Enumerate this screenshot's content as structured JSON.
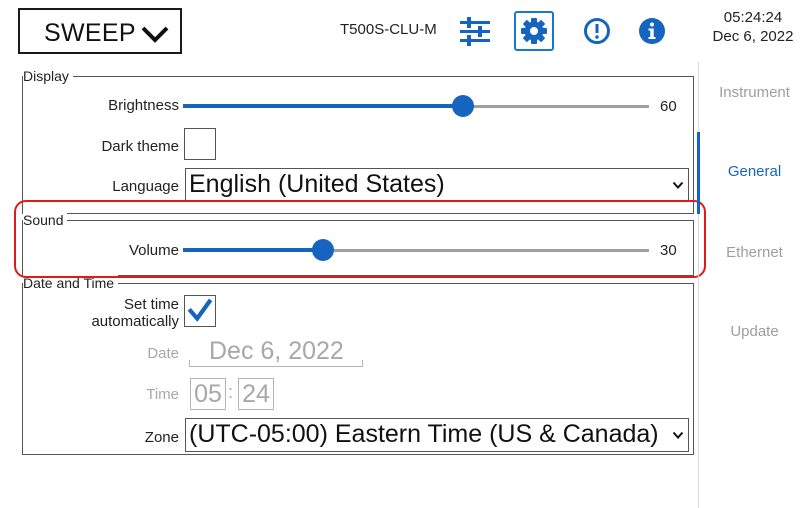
{
  "header": {
    "mode_label": "SWEEP",
    "device_name": "T500S-CLU-M",
    "time": "05:24:24",
    "date": "Dec 6, 2022",
    "icons": [
      "chevron-down-icon",
      "sliders-icon",
      "gear-icon",
      "alert-icon",
      "info-icon"
    ]
  },
  "nav": {
    "items": [
      {
        "label": "Instrument",
        "active": false
      },
      {
        "label": "General",
        "active": true
      },
      {
        "label": "Ethernet",
        "active": false
      },
      {
        "label": "Update",
        "active": false
      }
    ]
  },
  "display": {
    "title": "Display",
    "brightness_label": "Brightness",
    "brightness_value": "60",
    "brightness_fraction": 0.6,
    "dark_theme_label": "Dark theme",
    "dark_theme_checked": false,
    "language_label": "Language",
    "language_value": "English (United States)"
  },
  "sound": {
    "title": "Sound",
    "volume_label": "Volume",
    "volume_value": "30",
    "volume_fraction": 0.3
  },
  "datetime": {
    "title": "Date and Time",
    "set_time_label_line1": "Set time",
    "set_time_label_line2": "automatically",
    "set_time_checked": true,
    "date_label": "Date",
    "date_value": "Dec 6, 2022",
    "time_label": "Time",
    "time_hours": "05",
    "time_separator": ":",
    "time_minutes": "24",
    "zone_label": "Zone",
    "zone_value": "(UTC-05:00) Eastern Time (US & Canada)"
  },
  "colors": {
    "accent": "#1565c0",
    "highlight": "#e01919",
    "disabled_text": "#a8a8a8"
  }
}
